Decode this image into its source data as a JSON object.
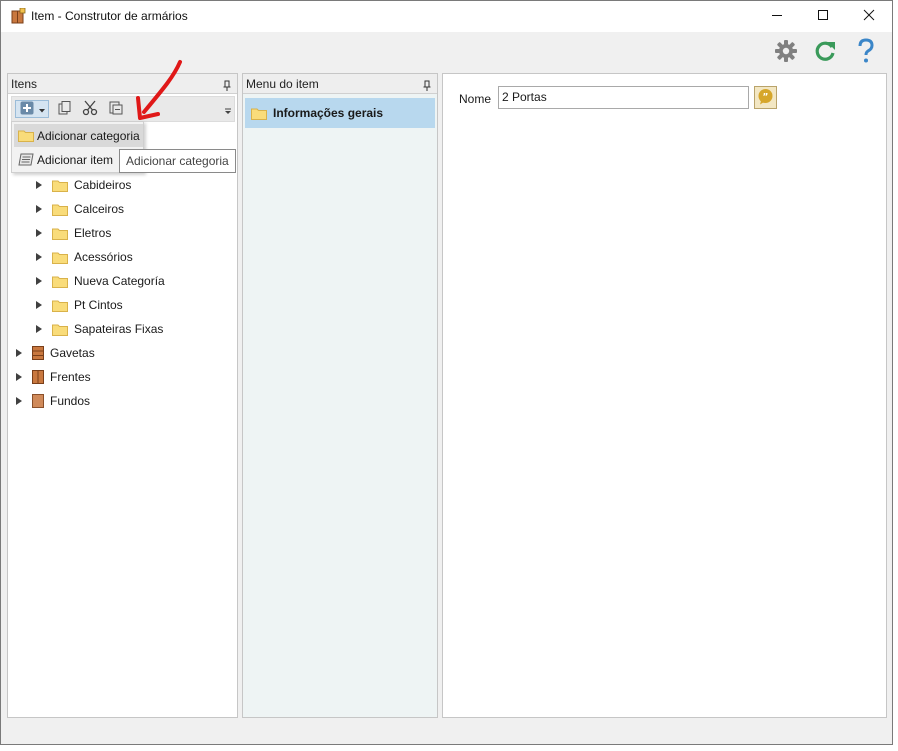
{
  "window": {
    "title": "Item - Construtor de armários",
    "icons": {
      "app": "wardrobe-icon",
      "minimize": "minimize-icon",
      "maximize": "maximize-icon",
      "close": "close-icon"
    }
  },
  "top_toolbar": {
    "icons": [
      "gear-icon",
      "refresh-icon",
      "help-icon"
    ],
    "colors": {
      "gear": "#808080",
      "refresh": "#3a9a5a",
      "help": "#3b86c8"
    }
  },
  "items_panel": {
    "title": "Itens",
    "toolbar_icons": [
      "add-icon",
      "dropdown-arrow-icon",
      "copy-icon",
      "cut-icon",
      "paste-icon"
    ],
    "dropdown": {
      "items": [
        {
          "label": "Adicionar categoria",
          "icon": "folder-icon"
        },
        {
          "label": "Adicionar item",
          "icon": "item-icon"
        }
      ]
    },
    "tooltip": "Adicionar categoria",
    "tree": [
      {
        "label": "Cabideiros",
        "icon": "folder-icon"
      },
      {
        "label": "Calceiros",
        "icon": "folder-icon"
      },
      {
        "label": "Eletros",
        "icon": "folder-icon"
      },
      {
        "label": "Acessórios",
        "icon": "folder-icon"
      },
      {
        "label": "Nueva Categoría",
        "icon": "folder-icon"
      },
      {
        "label": "Pt Cintos",
        "icon": "folder-icon"
      },
      {
        "label": "Sapateiras Fixas",
        "icon": "folder-icon"
      },
      {
        "label": "Gavetas",
        "icon": "drawer-icon"
      },
      {
        "label": "Frentes",
        "icon": "door-icon"
      },
      {
        "label": "Fundos",
        "icon": "panel-icon"
      }
    ]
  },
  "menu_panel": {
    "title": "Menu do item",
    "items": [
      {
        "label": "Informações gerais",
        "icon": "folder-icon"
      }
    ]
  },
  "detail_panel": {
    "name_label": "Nome",
    "name_value": "2 Portas",
    "translate_icon": "translate-icon"
  },
  "colors": {
    "selection": "#b8d8ee",
    "folder": "#f9dc7a",
    "annotation_arrow": "#e01818"
  }
}
